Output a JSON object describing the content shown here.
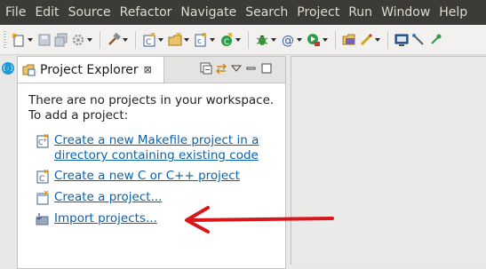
{
  "menubar": {
    "items": [
      "File",
      "Edit",
      "Source",
      "Refactor",
      "Navigate",
      "Search",
      "Project",
      "Run",
      "Window",
      "Help"
    ]
  },
  "toolbar": {
    "icons": [
      "new-wizard-icon",
      "save-icon",
      "save-all-icon",
      "settings-icon",
      "build-hammer-icon",
      "new-c-project-icon",
      "new-folder-icon",
      "new-c-file-icon",
      "new-class-icon",
      "debug-bug-icon",
      "at-icon",
      "run-icon",
      "open-folder-icon",
      "pen-icon",
      "console-icon",
      "tool-icon",
      "pin-icon"
    ]
  },
  "left_trim": {
    "icon": "restore-view-icon",
    "label": "{:}"
  },
  "project_explorer": {
    "tab_label": "Project Explorer",
    "close_glyph": "⊠",
    "empty_message_line1": "There are no projects in your workspace.",
    "empty_message_line2": "To add a project:",
    "actions": [
      {
        "line1": "Create a new Makefile project in a",
        "line2": "directory containing existing code",
        "icon": "makefile-project-icon"
      },
      {
        "line1": "Create a new C or C++ project",
        "icon": "c-project-icon"
      },
      {
        "line1": "Create a project...",
        "icon": "new-project-icon"
      },
      {
        "line1": "Import projects...",
        "icon": "import-icon"
      }
    ]
  },
  "annotation": {
    "color": "#d9161b"
  },
  "colors": {
    "menubar_bg": "#3c3b37",
    "link": "#0b62a8",
    "accent": "#1e9ad6"
  }
}
